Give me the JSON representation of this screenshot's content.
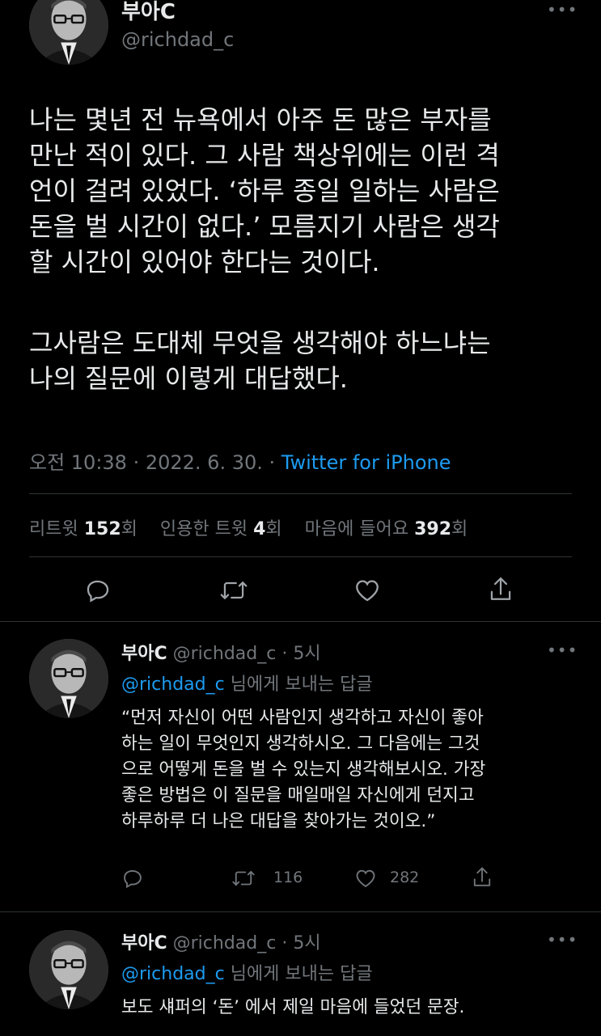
{
  "main_tweet": {
    "display_name": "부아C",
    "handle": "@richdad_c",
    "paragraphs": [
      [
        "나는 몇년 전 뉴욕에서 아주 돈 많은 부자를",
        "만난 적이 있다. 그 사람 책상위에는 이런 격",
        "언이 걸려 있었다. ‘하루 종일 일하는 사람은",
        "돈을 벌 시간이 없다.’ 모름지기 사람은 생각",
        "할 시간이 있어야 한다는 것이다."
      ],
      [
        "그사람은 도대체 무엇을 생각해야 하느냐는",
        "나의 질문에 이렇게 대답했다."
      ]
    ],
    "timestamp": "오전 10:38 · 2022. 6. 30. · ",
    "source": "Twitter for iPhone",
    "stats": {
      "retweet_label": "리트윗 ",
      "retweet_count": "152",
      "retweet_suffix": "회",
      "quote_label": "인용한 트윗 ",
      "quote_count": "4",
      "quote_suffix": "회",
      "like_label": "마음에 들어요 ",
      "like_count": "392",
      "like_suffix": "회"
    }
  },
  "replies": [
    {
      "display_name": "부아C",
      "handle_time": "@richdad_c · 5시",
      "reply_to_handle": "@richdad_c",
      "reply_to_suffix": " 님에게 보내는 답글",
      "lines": [
        "“먼저 자신이 어떤 사람인지 생각하고 자신이 좋아",
        "하는 일이 무엇인지 생각하시오. 그 다음에는 그것",
        "으로 어떻게 돈을 벌 수 있는지 생각해보시오. 가장",
        "좋은 방법은 이 질문을 매일매일 자신에게 던지고",
        "하루하루 더 나은 대답을 찾아가는 것이오.”"
      ],
      "retweets": "116",
      "likes": "282"
    },
    {
      "display_name": "부아C",
      "handle_time": "@richdad_c · 5시",
      "reply_to_handle": "@richdad_c",
      "reply_to_suffix": " 님에게 보내는 답글",
      "lines": [
        "보도 섀퍼의 ‘돈’ 에서 제일 마음에 들었던 문장."
      ]
    }
  ],
  "icons": [
    "more-icon",
    "reply-icon",
    "retweet-icon",
    "like-icon",
    "share-icon",
    "avatar"
  ],
  "colors": {
    "background": "#000000",
    "text": "#e7e9ea",
    "secondary": "#71767b",
    "link": "#1d9bf0",
    "divider": "#2f3336"
  }
}
